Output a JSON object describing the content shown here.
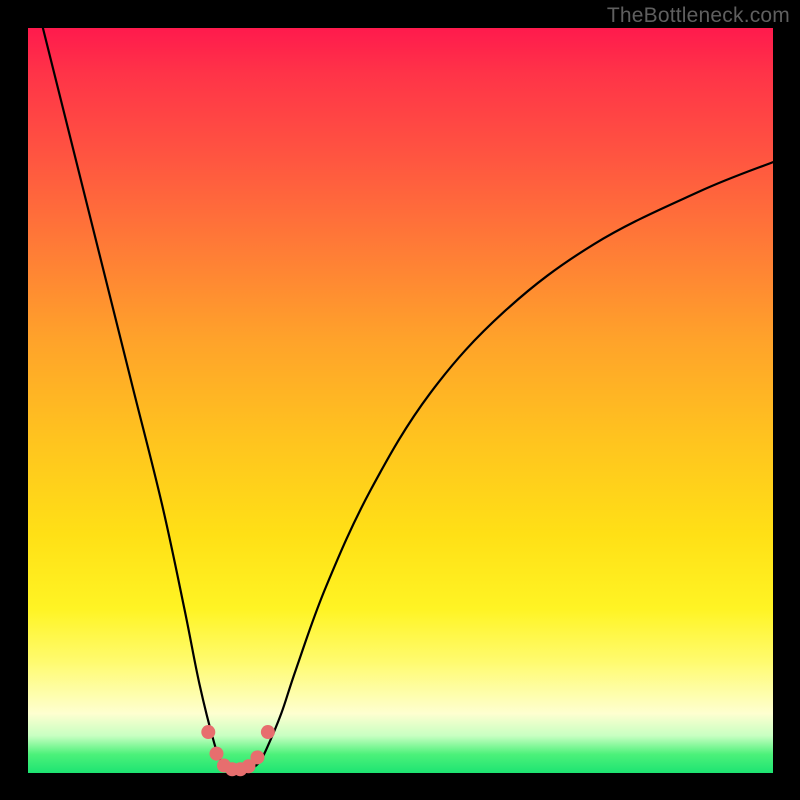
{
  "watermark": "TheBottleneck.com",
  "chart_data": {
    "type": "line",
    "title": "",
    "xlabel": "",
    "ylabel": "",
    "xlim": [
      0,
      100
    ],
    "ylim": [
      0,
      100
    ],
    "series": [
      {
        "name": "bottleneck-curve",
        "x": [
          2,
          5,
          10,
          14,
          18,
          21,
          23,
          25,
          26,
          27,
          28,
          29,
          30,
          31,
          32,
          34,
          36,
          40,
          46,
          54,
          64,
          76,
          90,
          100
        ],
        "y": [
          100,
          88,
          68,
          52,
          36,
          22,
          12,
          4,
          1.5,
          0.6,
          0.3,
          0.3,
          0.6,
          1.4,
          3.2,
          8,
          14,
          25,
          38,
          51,
          62,
          71,
          78,
          82
        ]
      }
    ],
    "markers": {
      "name": "highlight-points",
      "color": "#e76e6e",
      "points": [
        {
          "x": 24.2,
          "y": 5.5
        },
        {
          "x": 25.3,
          "y": 2.6
        },
        {
          "x": 26.3,
          "y": 1.0
        },
        {
          "x": 27.4,
          "y": 0.5
        },
        {
          "x": 28.5,
          "y": 0.5
        },
        {
          "x": 29.6,
          "y": 0.9
        },
        {
          "x": 30.8,
          "y": 2.1
        },
        {
          "x": 32.2,
          "y": 5.5
        }
      ]
    }
  }
}
